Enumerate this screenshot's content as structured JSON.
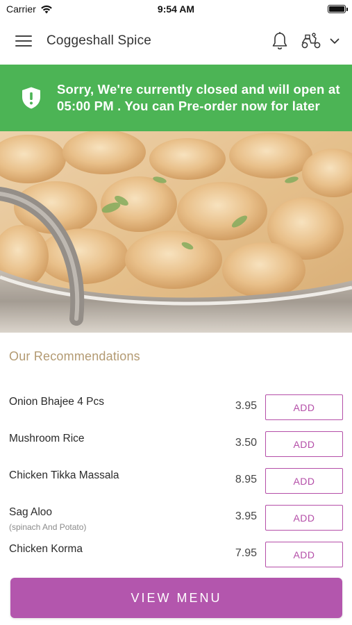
{
  "status_bar": {
    "carrier": "Carrier",
    "time": "9:54 AM"
  },
  "header": {
    "title": "Coggeshall Spice",
    "icons": [
      "menu-icon",
      "bell-icon",
      "scooter-icon",
      "chevron-down-icon"
    ]
  },
  "banner": {
    "message": "Sorry, We're currently closed and will open at 05:00 PM . You can Pre-order now for later",
    "icon": "shield-alert-icon",
    "color": "#4cb455"
  },
  "hero": {
    "description_icon": "curry-dish-image"
  },
  "recommendations": {
    "title": "Our Recommendations",
    "items": [
      {
        "name": "Onion Bhajee 4 Pcs",
        "subtitle": "",
        "price": "3.95",
        "button": "ADD"
      },
      {
        "name": "Mushroom Rice",
        "subtitle": "",
        "price": "3.50",
        "button": "ADD"
      },
      {
        "name": "Chicken Tikka Massala",
        "subtitle": "",
        "price": "8.95",
        "button": "ADD"
      },
      {
        "name": "Sag Aloo",
        "subtitle": "(spinach And Potato)",
        "price": "3.95",
        "button": "ADD"
      },
      {
        "name": "Chicken Korma",
        "subtitle": "",
        "price": "7.95",
        "button": "ADD"
      }
    ]
  },
  "footer": {
    "view_menu_label": "VIEW MENU",
    "accent_color": "#b356ad"
  }
}
